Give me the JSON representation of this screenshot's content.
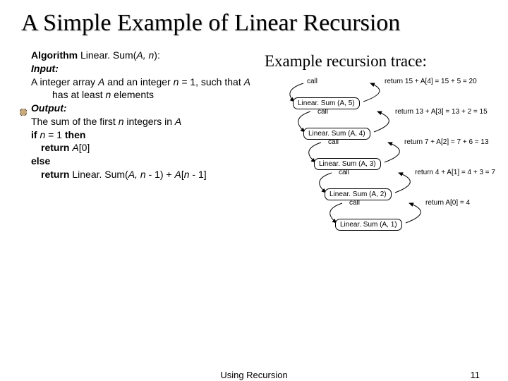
{
  "title": "A Simple Example of Linear Recursion",
  "algo": {
    "header_kw": "Algorithm",
    "header_rest": " Linear. Sum(",
    "header_args": "A, n",
    "header_close": "):",
    "input_kw": "Input:",
    "input_line_a": " A integer array ",
    "input_line_b": "A",
    "input_line_c": " and an integer",
    "input_line2_a": "n = ",
    "input_line2_b": "1, such that ",
    "input_line2_c": "A",
    "input_line2_d": " has at least ",
    "input_line3_a": "n",
    "input_line3_b": " elements",
    "output_kw": "Output:",
    "output_line_a": " The sum of the first ",
    "output_line_b": "n",
    "output_line_c": " integers in ",
    "output_line_d": "A",
    "if_kw": "if ",
    "if_cond_a": "n",
    "if_cond_b": " = 1 ",
    "then_kw": "then",
    "ret1_kw": "return ",
    "ret1_a": "A",
    "ret1_b": "[0]",
    "else_kw": "else",
    "ret2_kw": "return ",
    "ret2_a": "Linear. Sum(",
    "ret2_b": "A, n",
    "ret2_c": " - 1) + ",
    "ret2_d": "A",
    "ret2_e": "[",
    "ret2_f": "n",
    "ret2_g": " - 1]"
  },
  "trace_title": "Example recursion trace:",
  "trace": {
    "calls": [
      "call",
      "call",
      "call",
      "call",
      "call"
    ],
    "returns": [
      "return 15 + A[4] = 15 + 5 = 20",
      "return 13 + A[3] = 13 + 2 = 15",
      "return 7 + A[2] = 7 + 6 = 13",
      "return 4 + A[1] = 4 + 3 = 7",
      "return A[0] = 4"
    ],
    "boxes": [
      "Linear. Sum (A, 5)",
      "Linear. Sum (A, 4)",
      "Linear. Sum (A, 3)",
      "Linear. Sum (A, 2)",
      "Linear. Sum (A, 1)"
    ]
  },
  "footer_center": "Using Recursion",
  "footer_page": "11"
}
